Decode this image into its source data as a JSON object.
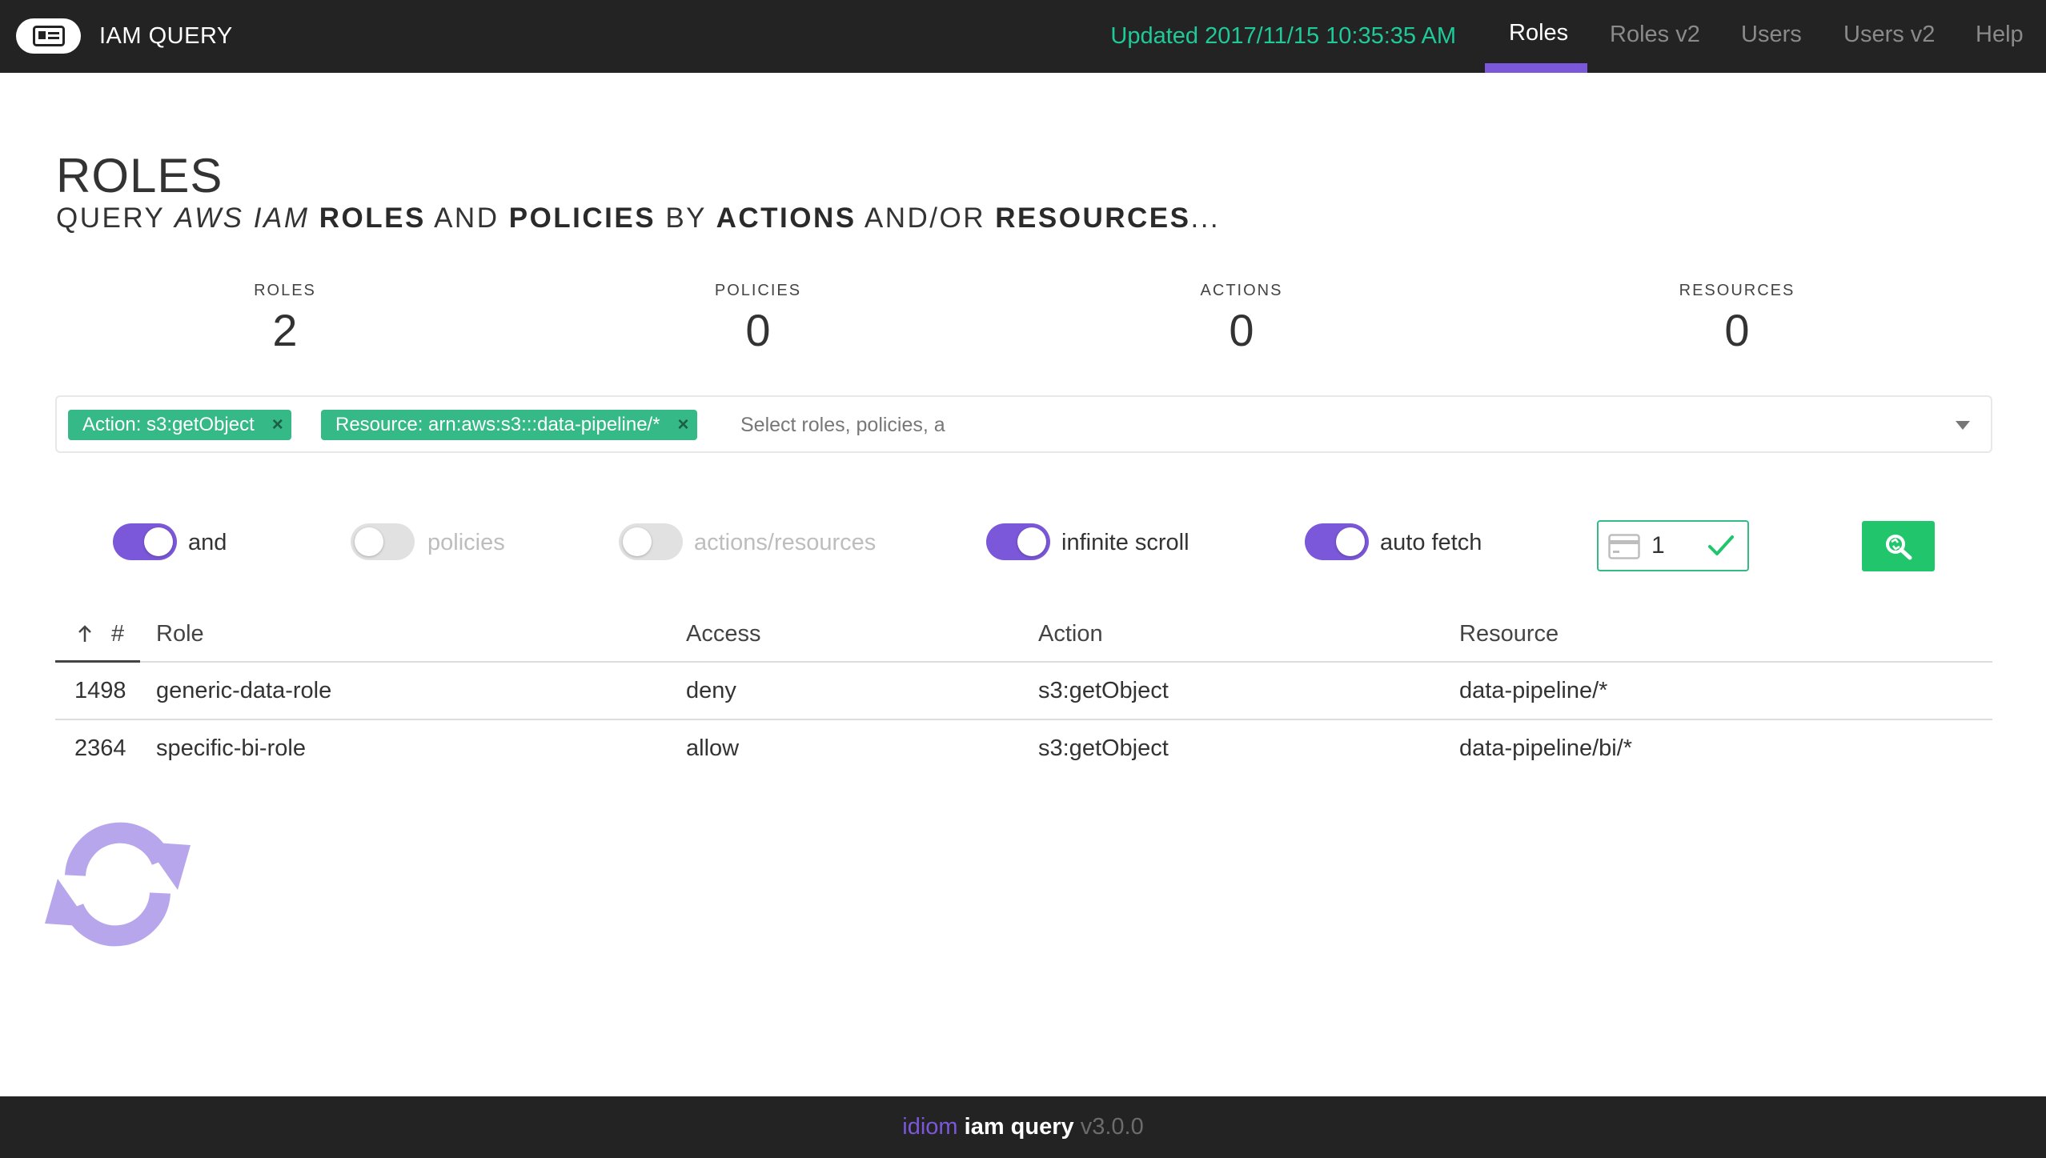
{
  "header": {
    "logo_icon": "id-card-icon",
    "app_title": "IAM QUERY",
    "updated": "Updated 2017/11/15 10:35:35 AM",
    "updated_color": "#1fc99a",
    "nav": [
      "Roles",
      "Roles v2",
      "Users",
      "Users v2",
      "Help"
    ],
    "active_nav": "Roles",
    "accent_color": "#7b57d9"
  },
  "page": {
    "title": "ROLES",
    "subtitle_parts": [
      "QUERY ",
      "AWS IAM",
      " ",
      "ROLES",
      " AND ",
      "POLICIES",
      " BY ",
      "ACTIONS",
      " AND/OR ",
      "RESOURCES",
      "..."
    ]
  },
  "stats": [
    {
      "label": "ROLES",
      "value": "2"
    },
    {
      "label": "POLICIES",
      "value": "0"
    },
    {
      "label": "ACTIONS",
      "value": "0"
    },
    {
      "label": "RESOURCES",
      "value": "0"
    }
  ],
  "filter": {
    "chips": [
      "Action: s3:getObject",
      "Resource: arn:aws:s3:::data-pipeline/*"
    ],
    "chip_remove": "×",
    "placeholder": "Select roles, policies, a",
    "chip_color": "#34b987"
  },
  "toggles": [
    {
      "label": "and",
      "on": true
    },
    {
      "label": "policies",
      "on": false
    },
    {
      "label": "actions/resources",
      "on": false
    },
    {
      "label": "infinite scroll",
      "on": true
    },
    {
      "label": "auto fetch",
      "on": true
    }
  ],
  "page_field": {
    "value": "1",
    "icon": "credit-card-icon",
    "confirm_icon": "checkmark-icon"
  },
  "search_button": {
    "icon": "search-refresh-icon",
    "color": "#21c56b"
  },
  "table": {
    "headers": {
      "num": "#",
      "role": "Role",
      "access": "Access",
      "action": "Action",
      "resource": "Resource"
    },
    "sort_icon": "arrow-up-icon",
    "rows": [
      {
        "num": "1498",
        "role": "generic-data-role",
        "access": "deny",
        "action": "s3:getObject",
        "resource": "data-pipeline/*"
      },
      {
        "num": "2364",
        "role": "specific-bi-role",
        "access": "allow",
        "action": "s3:getObject",
        "resource": "data-pipeline/bi/*"
      }
    ]
  },
  "loading_icon": "refresh-spinner-icon",
  "footer": {
    "brand": "idiom",
    "product": "iam query",
    "version": "v3.0.0"
  }
}
